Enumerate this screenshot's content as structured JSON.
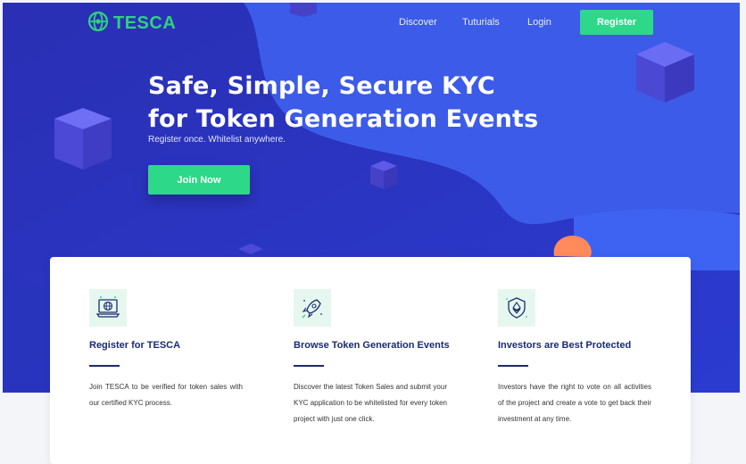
{
  "brand": {
    "name": "TESCA",
    "color": "#2fd180"
  },
  "nav": {
    "links": [
      "Discover",
      "Tuturials",
      "Login"
    ],
    "register_label": "Register"
  },
  "hero": {
    "headline_line1": "Safe, Simple, Secure KYC",
    "headline_line2": "for Token Generation Events",
    "subline": "Register once. Whitelist anywhere.",
    "join_label": "Join Now",
    "bg_color": "#3149d8",
    "accent_color": "#2dd888"
  },
  "features": [
    {
      "icon": "laptop-globe-icon",
      "title": "Register for TESCA",
      "description": "Join TESCA to be verified for token sales  with our certified KYC process."
    },
    {
      "icon": "rocket-icon",
      "title": "Browse Token Generation Events",
      "description": "Discover the latest Token Sales and submit your KYC application to be whitelisted for every token project with just one click."
    },
    {
      "icon": "shield-ethereum-icon",
      "title": "Investors are Best Protected",
      "description": "Investors have the right to vote on all activities of the project and create a vote to get back their investment at any time."
    }
  ]
}
